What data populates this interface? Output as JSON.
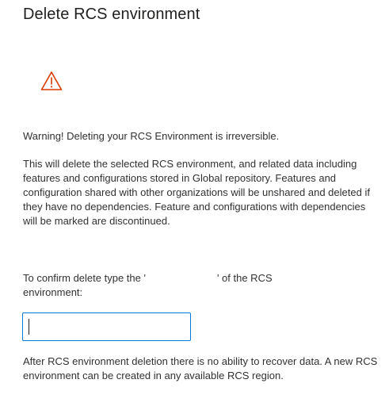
{
  "dialog": {
    "title": "Delete RCS environment",
    "warning_icon": "warning-triangle-icon",
    "warning_color": "#d83b01",
    "accent_color": "#0078d4",
    "warning_text": "Warning! Deleting your RCS Environment is irreversible.",
    "description": "This will delete the selected RCS environment, and related data including features and configurations stored in Global repository. Features and configuration shared with other organizations will be unshared and deleted if they have no dependencies. Feature and configurations with dependencies will be marked are discontinued.",
    "confirm_prefix": "To confirm delete type the '",
    "confirm_suffix": "' of the RCS",
    "confirm_line2": "environment:",
    "confirm_input_value": "",
    "after_text": "After RCS environment deletion there is no ability to recover data. A new RCS environment can be created in any available RCS region."
  }
}
